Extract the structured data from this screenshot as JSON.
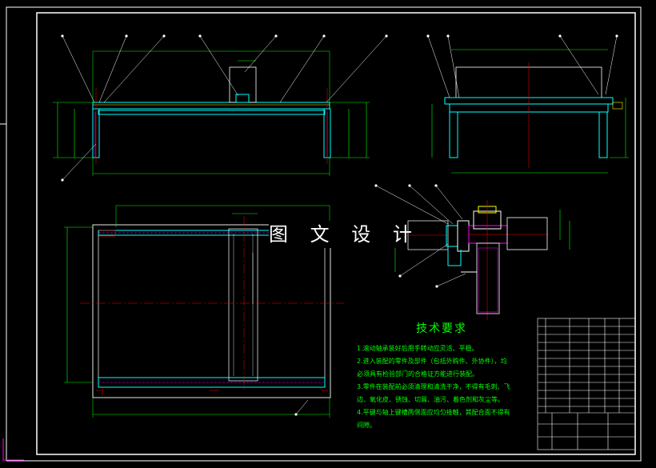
{
  "drawing": {
    "watermark": "图 文 设 计",
    "tech_requirements": {
      "title": "技术要求",
      "lines": [
        "1.滚动轴承装好后用手转动应灵活、平稳。",
        "2.进入装配的零件及部件（包括外购件、外协件），均",
        "必须具有检验部门的合格证方能进行装配。",
        "3.零件在装配前必须清理和清洗干净，不得有毛刺、飞",
        "边、氧化皮、锈蚀、切屑、油污、着色剂和灰尘等。",
        "4.平键与轴上键槽两侧面应均匀接触，其配合面不得有",
        "间隙。"
      ]
    },
    "colors": {
      "background": "#000000",
      "frame": "#ffffff",
      "outline": "#00ffff",
      "dimension": "#00ff00",
      "centerline": "#ff0000",
      "accent": "#ffff00",
      "hatch": "#ff00ff"
    }
  }
}
